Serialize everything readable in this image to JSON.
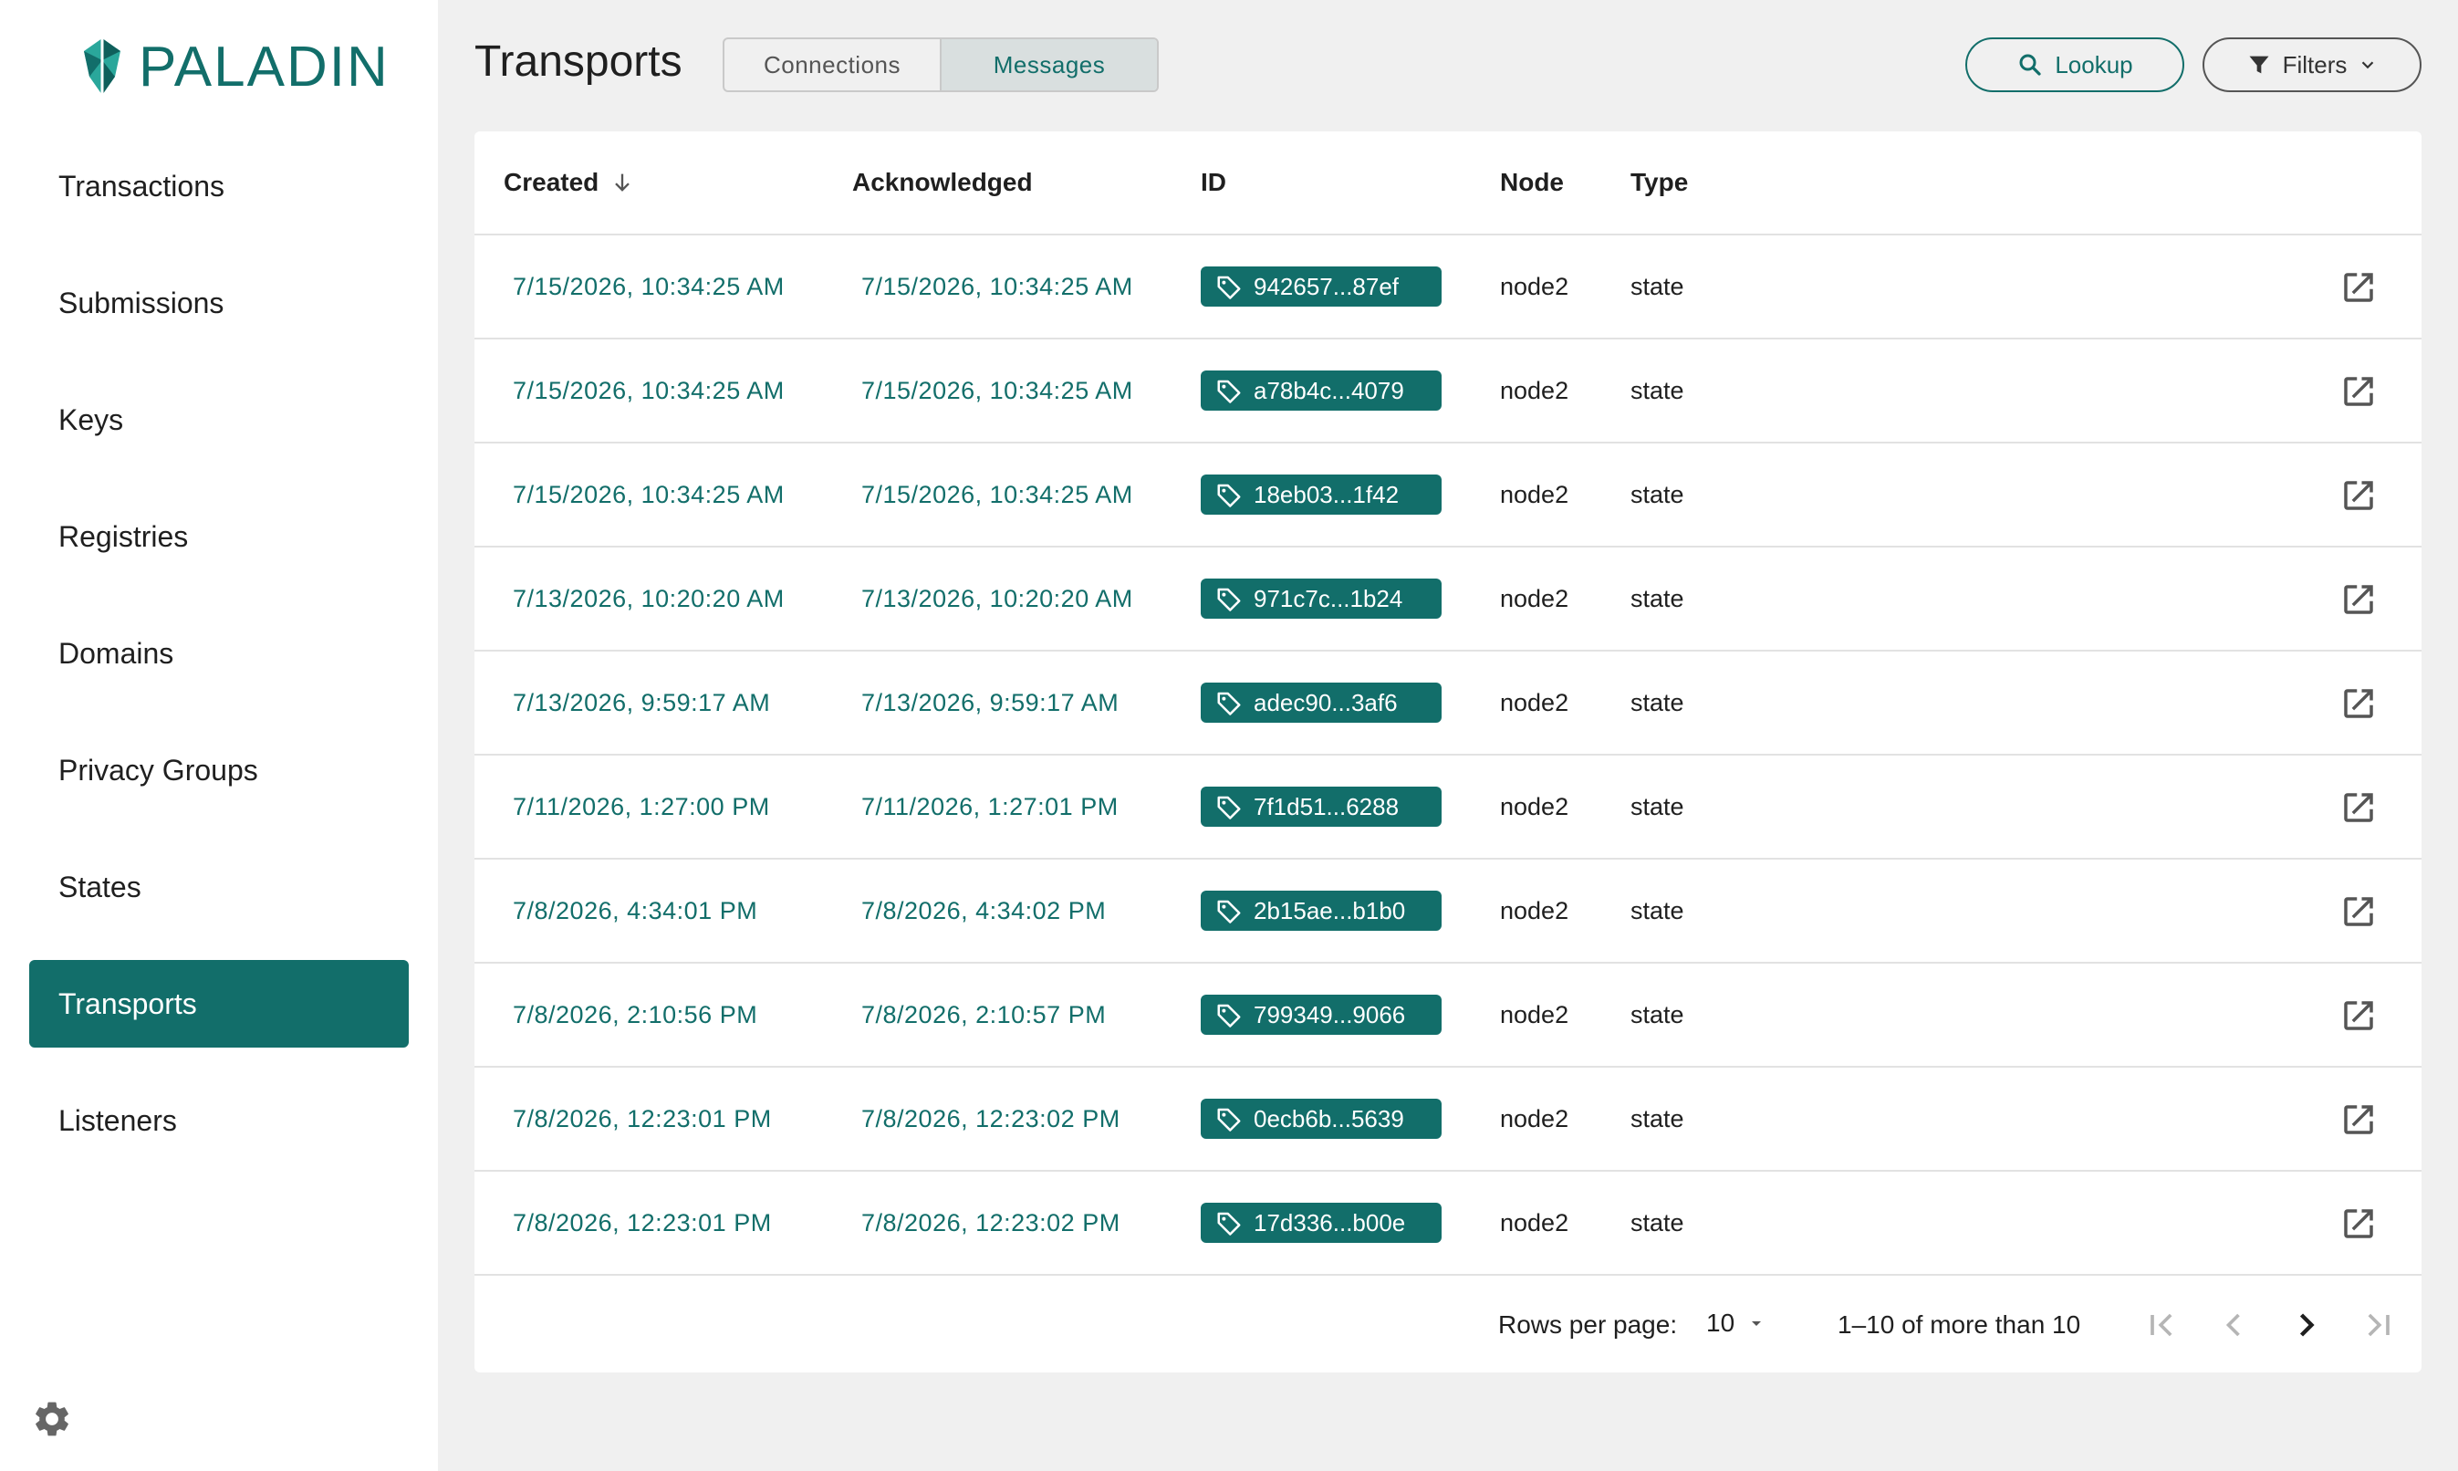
{
  "app": {
    "logo_text": "PALADIN"
  },
  "sidebar": {
    "items": [
      {
        "label": "Transactions",
        "active": false
      },
      {
        "label": "Submissions",
        "active": false
      },
      {
        "label": "Keys",
        "active": false
      },
      {
        "label": "Registries",
        "active": false
      },
      {
        "label": "Domains",
        "active": false
      },
      {
        "label": "Privacy Groups",
        "active": false
      },
      {
        "label": "States",
        "active": false
      },
      {
        "label": "Transports",
        "active": true
      },
      {
        "label": "Listeners",
        "active": false
      }
    ],
    "settings_icon": "gear-icon"
  },
  "header": {
    "title": "Transports",
    "tabs": [
      {
        "label": "Connections",
        "selected": false
      },
      {
        "label": "Messages",
        "selected": true
      }
    ],
    "lookup_label": "Lookup",
    "filters_label": "Filters"
  },
  "table": {
    "columns": {
      "created": "Created",
      "acknowledged": "Acknowledged",
      "id": "ID",
      "node": "Node",
      "type": "Type"
    },
    "rows": [
      {
        "created": "7/15/2026, 10:34:25 AM",
        "acknowledged": "7/15/2026, 10:34:25 AM",
        "id": "942657...87ef",
        "node": "node2",
        "type": "state"
      },
      {
        "created": "7/15/2026, 10:34:25 AM",
        "acknowledged": "7/15/2026, 10:34:25 AM",
        "id": "a78b4c...4079",
        "node": "node2",
        "type": "state"
      },
      {
        "created": "7/15/2026, 10:34:25 AM",
        "acknowledged": "7/15/2026, 10:34:25 AM",
        "id": "18eb03...1f42",
        "node": "node2",
        "type": "state"
      },
      {
        "created": "7/13/2026, 10:20:20 AM",
        "acknowledged": "7/13/2026, 10:20:20 AM",
        "id": "971c7c...1b24",
        "node": "node2",
        "type": "state"
      },
      {
        "created": "7/13/2026, 9:59:17 AM",
        "acknowledged": "7/13/2026, 9:59:17 AM",
        "id": "adec90...3af6",
        "node": "node2",
        "type": "state"
      },
      {
        "created": "7/11/2026, 1:27:00 PM",
        "acknowledged": "7/11/2026, 1:27:01 PM",
        "id": "7f1d51...6288",
        "node": "node2",
        "type": "state"
      },
      {
        "created": "7/8/2026, 4:34:01 PM",
        "acknowledged": "7/8/2026, 4:34:02 PM",
        "id": "2b15ae...b1b0",
        "node": "node2",
        "type": "state"
      },
      {
        "created": "7/8/2026, 2:10:56 PM",
        "acknowledged": "7/8/2026, 2:10:57 PM",
        "id": "799349...9066",
        "node": "node2",
        "type": "state"
      },
      {
        "created": "7/8/2026, 12:23:01 PM",
        "acknowledged": "7/8/2026, 12:23:02 PM",
        "id": "0ecb6b...5639",
        "node": "node2",
        "type": "state"
      },
      {
        "created": "7/8/2026, 12:23:01 PM",
        "acknowledged": "7/8/2026, 12:23:02 PM",
        "id": "17d336...b00e",
        "node": "node2",
        "type": "state"
      }
    ]
  },
  "pagination": {
    "rows_per_page_label": "Rows per page:",
    "rows_per_page_value": "10",
    "range_text": "1–10 of more than 10"
  },
  "colors": {
    "accent": "#126e6a",
    "background": "#f0f0f0"
  }
}
